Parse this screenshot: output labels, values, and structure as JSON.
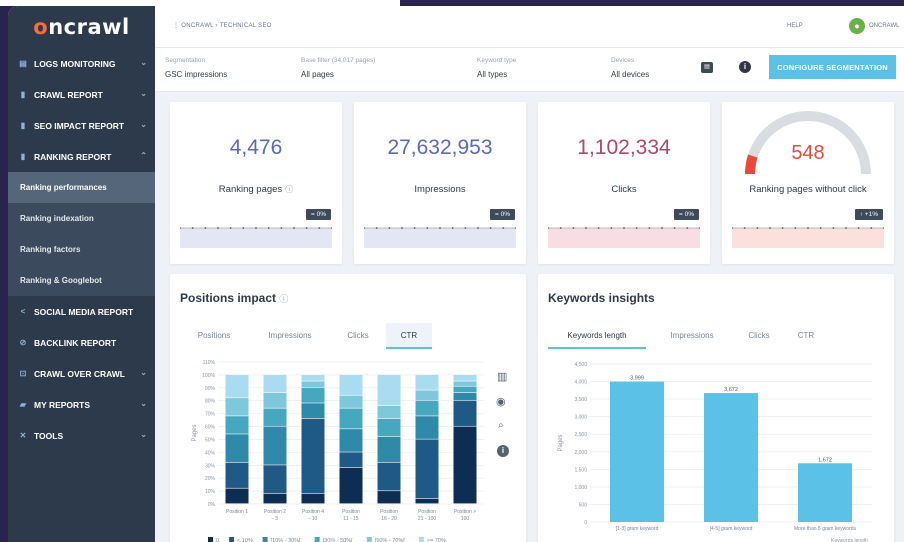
{
  "logo": {
    "prefix": "o",
    "rest": "ncrawl"
  },
  "sidebar": {
    "items": [
      {
        "label": "LOGS MONITORING",
        "icon": "logs-icon",
        "glyph": "▤",
        "chevron": "⌄"
      },
      {
        "label": "CRAWL REPORT",
        "icon": "bar-chart-icon",
        "glyph": "▮",
        "chevron": "⌄"
      },
      {
        "label": "SEO IMPACT REPORT",
        "icon": "bar-chart-icon",
        "glyph": "▮",
        "chevron": "⌄"
      },
      {
        "label": "RANKING REPORT",
        "icon": "bar-chart-icon",
        "glyph": "▮",
        "chevron": "⌃"
      }
    ],
    "sub_items": [
      {
        "label": "Ranking performances",
        "active": true
      },
      {
        "label": "Ranking indexation"
      },
      {
        "label": "Ranking factors"
      },
      {
        "label": "Ranking & Googlebot"
      }
    ],
    "items2": [
      {
        "label": "SOCIAL MEDIA REPORT",
        "icon": "share-icon",
        "glyph": "<",
        "chevron": ""
      },
      {
        "label": "BACKLINK REPORT",
        "icon": "link-icon",
        "glyph": "⊘",
        "chevron": ""
      },
      {
        "label": "CRAWL OVER CRAWL",
        "icon": "compare-icon",
        "glyph": "⊡",
        "chevron": "⌄"
      },
      {
        "label": "MY REPORTS",
        "icon": "folder-icon",
        "glyph": "▰",
        "chevron": "⌄"
      },
      {
        "label": "TOOLS",
        "icon": "tools-icon",
        "glyph": "✕",
        "chevron": "⌄"
      }
    ]
  },
  "topbar": {
    "breadcrumb": "⋮  ONCRAWL  ›  TECHNICAL SEO",
    "help": "HELP",
    "user": "ONCRAWL"
  },
  "filters": [
    {
      "label": "Segmentation",
      "value": "GSC impressions"
    },
    {
      "label": "Base filter (34,017 pages)",
      "value": "All pages"
    },
    {
      "label": "Keyword type",
      "value": "All types"
    },
    {
      "label": "Devices",
      "value": "All devices"
    }
  ],
  "config_button": "CONFIGURE SEGMENTATION",
  "kpis": [
    {
      "value": "4,476",
      "label": "Ranking pages",
      "badge": "= 0%",
      "color": "#5b6ab8",
      "fill": "#e4e6f4",
      "has_q": true
    },
    {
      "value": "27,632,953",
      "label": "Impressions",
      "badge": "= 0%",
      "color": "#5b6ab8",
      "fill": "#e4e6f4",
      "has_q": false
    },
    {
      "value": "1,102,334",
      "label": "Clicks",
      "badge": "= 0%",
      "color": "#b2476a",
      "fill": "#f9dde4",
      "has_q": false
    },
    {
      "value": "548",
      "label": "Ranking pages without click",
      "badge": "↑ +1%",
      "color": "#e84a3c",
      "fill": "#fbe0dc",
      "has_q": false,
      "gauge_fraction": 0.1
    }
  ],
  "positions_panel": {
    "title": "Positions impact",
    "tabs": [
      "Positions",
      "Impressions",
      "Clicks",
      "CTR"
    ],
    "active_tab": 3,
    "tools": [
      "bar-chart-icon",
      "eye-icon",
      "zoom-icon",
      "info-icon"
    ]
  },
  "keywords_panel": {
    "title": "Keywords insights",
    "tabs": [
      "Keywords length",
      "Impressions",
      "Clicks",
      "CTR"
    ],
    "active_tab": 0
  },
  "chart_data": [
    {
      "type": "bar",
      "stacked": true,
      "ylabel": "Pages",
      "ylim": [
        0,
        110
      ],
      "yticks": [
        "0%",
        "10%",
        "20%",
        "30%",
        "40%",
        "50%",
        "60%",
        "70%",
        "80%",
        "90%",
        "100%",
        "110%"
      ],
      "categories": [
        [
          "Position 1",
          ""
        ],
        [
          "Position 2",
          "- 3"
        ],
        [
          "Position 4",
          "- 10"
        ],
        [
          "Position",
          "11 - 15"
        ],
        [
          "Position",
          "16 - 20"
        ],
        [
          "Position",
          "21 - 100"
        ],
        [
          "Position >",
          "100"
        ]
      ],
      "series": [
        {
          "name": "0",
          "color": "#0d2d52",
          "values": [
            12,
            8,
            8,
            28,
            10,
            4,
            60
          ]
        },
        {
          "name": "< 10%",
          "color": "#1f5a86",
          "values": [
            20,
            22,
            58,
            12,
            22,
            46,
            20
          ]
        },
        {
          "name": "[10% - 30%[",
          "color": "#2e8aa8",
          "values": [
            22,
            30,
            12,
            18,
            20,
            18,
            6
          ]
        },
        {
          "name": "[30% - 50%[",
          "color": "#45a8bf",
          "values": [
            14,
            14,
            12,
            16,
            14,
            12,
            5
          ]
        },
        {
          "name": "[50% - 70%[",
          "color": "#7ec8dc",
          "values": [
            14,
            12,
            5,
            10,
            10,
            8,
            4
          ]
        },
        {
          "name": ">= 70%",
          "color": "#a9dcf0",
          "values": [
            18,
            14,
            5,
            16,
            24,
            12,
            5
          ]
        }
      ]
    },
    {
      "type": "bar",
      "ylabel": "Pages",
      "xlabel": "Keywords length",
      "ylim": [
        0,
        4500
      ],
      "yticks": [
        "0",
        "500",
        "1,000",
        "1,500",
        "2,000",
        "2,500",
        "3,000",
        "3,500",
        "4,000",
        "4,500"
      ],
      "categories": [
        "[1-3] gram keyword",
        "[4-5] gram keyword",
        "More than 5 gram keywords"
      ],
      "values": [
        3999,
        3672,
        1672
      ],
      "value_labels": [
        "3,999",
        "3,672",
        "1,672"
      ],
      "color": "#5cc1e6"
    }
  ]
}
